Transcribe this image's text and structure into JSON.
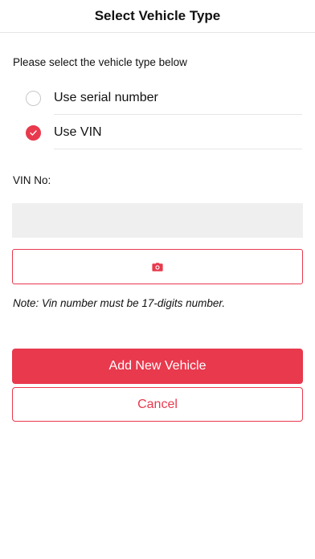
{
  "header": {
    "title": "Select Vehicle Type"
  },
  "form": {
    "prompt": "Please select the vehicle type below",
    "options": [
      {
        "label": "Use serial number",
        "selected": false
      },
      {
        "label": "Use VIN",
        "selected": true
      }
    ],
    "vin_label": "VIN No:",
    "vin_value": "",
    "scan_icon": "camera-icon",
    "note": "Note: Vin number must be 17-digits number."
  },
  "actions": {
    "add_label": "Add New Vehicle",
    "cancel_label": "Cancel"
  },
  "colors": {
    "accent": "#e8394d",
    "input_bg": "#efefef",
    "divider": "#e6e6e6"
  }
}
